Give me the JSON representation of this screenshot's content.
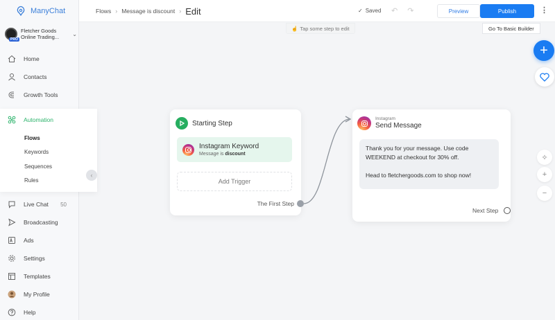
{
  "app": {
    "name": "ManyChat"
  },
  "account": {
    "name": "Fletcher Goods Online Trading...",
    "badge": "PRO"
  },
  "nav": {
    "home": "Home",
    "contacts": "Contacts",
    "growth_tools": "Growth Tools",
    "automation": "Automation",
    "sub": [
      "Flows",
      "Keywords",
      "Sequences",
      "Rules"
    ],
    "live_chat": "Live Chat",
    "live_chat_count": "50",
    "broadcasting": "Broadcasting",
    "ads": "Ads",
    "settings": "Settings",
    "templates": "Templates",
    "my_profile": "My Profile",
    "help": "Help"
  },
  "topbar": {
    "breadcrumb": [
      "Flows",
      "Message is discount"
    ],
    "current": "Edit",
    "saved": "Saved",
    "preview": "Preview",
    "publish": "Publish"
  },
  "hint": "Tap some step to edit",
  "basic_builder": "Go To Basic Builder",
  "start_step": {
    "title": "Starting Step",
    "trigger_title": "Instagram Keyword",
    "trigger_sub_prefix": "Message is",
    "trigger_sub_value": "discount",
    "add_trigger": "Add Trigger",
    "next_label": "The First Step"
  },
  "send_message": {
    "channel": "Instagram",
    "title": "Send Message",
    "text_1": "Thank you for your message. Use code WEEKEND at checkout for 30% off.",
    "text_2": "Head to fletchergoods.com to shop now!",
    "next_label": "Next Step"
  },
  "colors": {
    "accent": "#1a7cf2",
    "automation": "#2cb36b",
    "trigger_bg": "#e5f6ed"
  }
}
